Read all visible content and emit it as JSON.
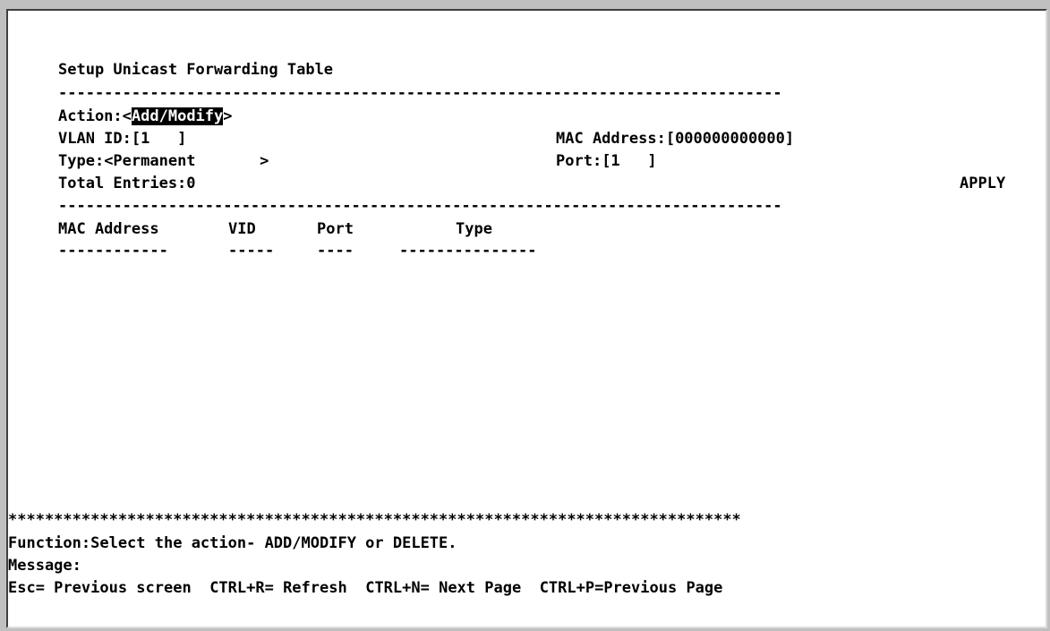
{
  "title": "Setup Unicast Forwarding Table",
  "separator": "-------------------------------------------------------------------------------",
  "form": {
    "action_label": "Action:",
    "action_value": "Add/Modify",
    "vlan_label": "VLAN ID:",
    "vlan_value": "[1   ]",
    "mac_label": "MAC Address:",
    "mac_value": "[000000000000]",
    "type_label": "Type:",
    "type_value": "<Permanent       >",
    "port_label": "Port:",
    "port_value": "[1   ]",
    "total_label": "Total Entries:",
    "total_value": "0",
    "apply_label": "APPLY"
  },
  "table": {
    "columns": [
      "MAC Address",
      "VID",
      "Port",
      "Type"
    ],
    "underlines": [
      "------------",
      "-----",
      "----",
      "---------------"
    ],
    "rows": []
  },
  "footer": {
    "stars": "********************************************************************************",
    "function_text": "Function:Select the action- ADD/MODIFY or DELETE.",
    "message_text": "Message:",
    "hotkeys": [
      "Esc= Previous screen",
      "CTRL+R= Refresh",
      "CTRL+N= Next Page",
      "CTRL+P=Previous Page"
    ]
  }
}
